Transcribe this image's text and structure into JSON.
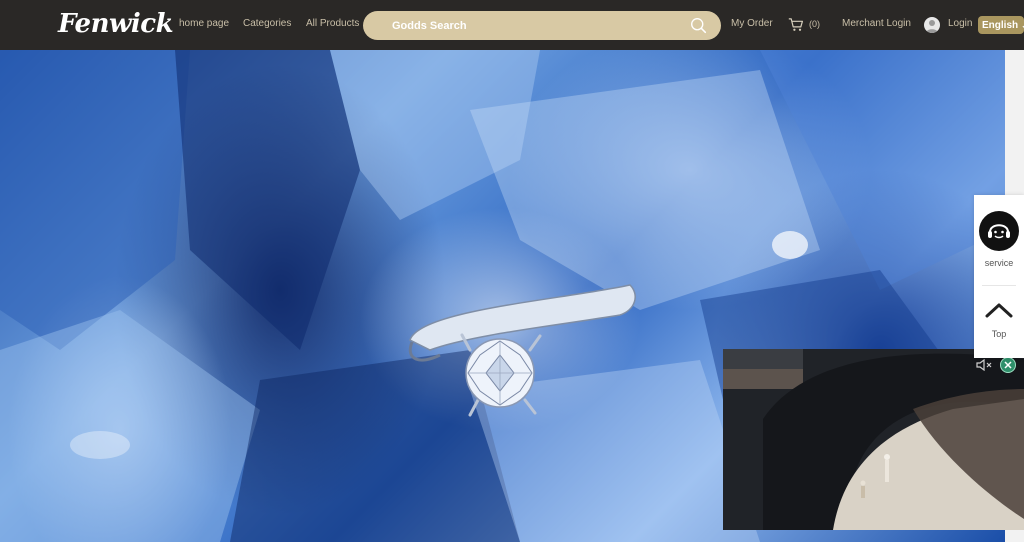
{
  "header": {
    "logo": "Fenwick",
    "nav": {
      "home": "home page",
      "categories": "Categories",
      "all_products": "All Products"
    },
    "search": {
      "placeholder": "Godds Search"
    },
    "my_order": "My Order",
    "cart_count": "(0)",
    "merchant_login": "Merchant Login",
    "login": "Login",
    "language": "English"
  },
  "hero": {
    "icon": "diamond-ring-banner"
  },
  "float_panel": {
    "service_label": "service",
    "top_label": "Top"
  },
  "video": {
    "icons": [
      "mute-icon",
      "close-icon"
    ]
  },
  "colors": {
    "header_bg": "#2a2826",
    "nav_text": "#c9bfa8",
    "search_bg": "#d8c9a4",
    "lang_bg": "#a9965f",
    "accent_green": "#2f8f6b"
  }
}
